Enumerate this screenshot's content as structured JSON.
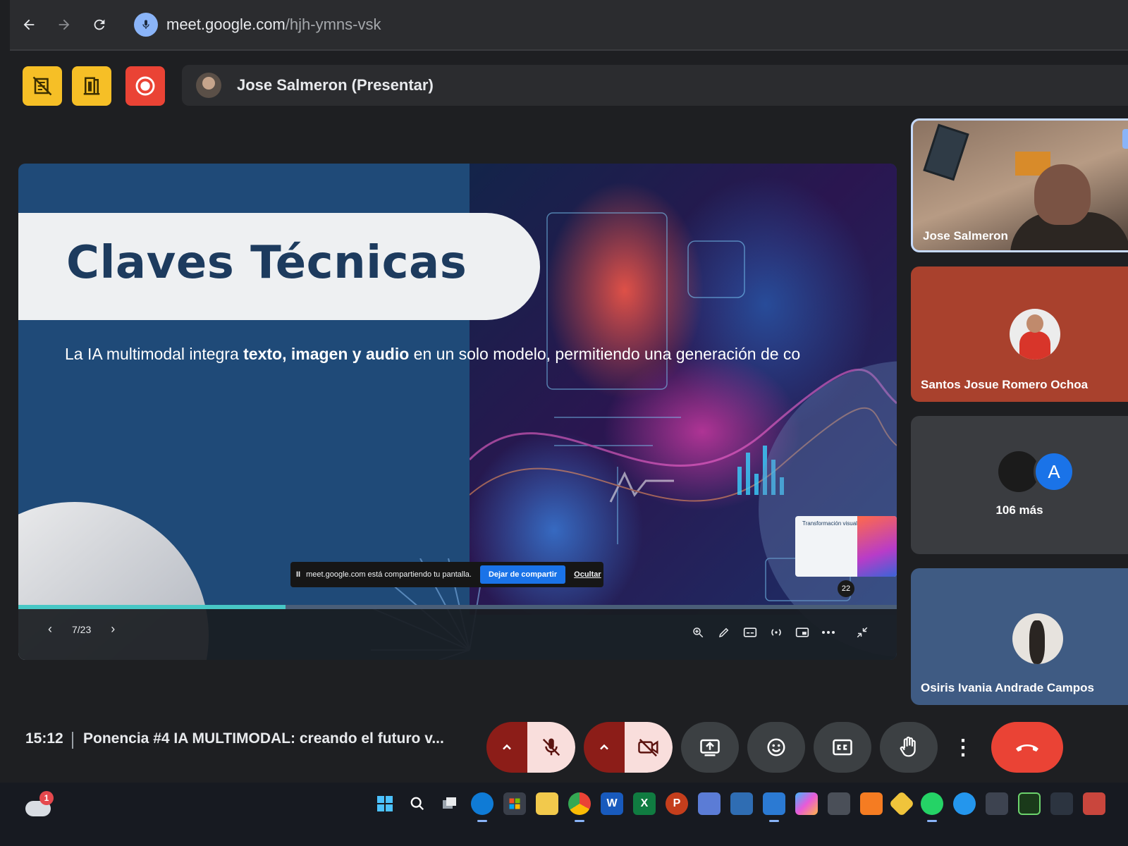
{
  "browser": {
    "url_host": "meet.google.com",
    "url_path": "/hjh-ymns-vsk",
    "icons": [
      "back-arrow-icon",
      "forward-arrow-icon",
      "reload-icon",
      "microphone-icon"
    ]
  },
  "presenter": {
    "name": "Jose Salmeron (Presentar)"
  },
  "slide": {
    "title": "Claves Técnicas",
    "text_prefix": "La IA multimodal integra ",
    "text_bold": "texto, imagen y audio",
    "text_suffix": " en un solo modelo, permitiendo una generación de co",
    "thumbnail_title": "Transformación visual",
    "badge_number": "22",
    "page_indicator": "7/23",
    "progress_fraction": 0.3043,
    "share_banner": {
      "pause_symbol": "II",
      "message": "meet.google.com está compartiendo tu pantalla.",
      "stop_label": "Dejar de compartir",
      "hide_label": "Ocultar"
    },
    "prev_symbol": "‹",
    "next_symbol": "›"
  },
  "participants": [
    {
      "name": "Jose Salmeron",
      "type": "video"
    },
    {
      "name": "Santos Josue Romero Ochoa",
      "type": "avatar"
    },
    {
      "more_letter": "A",
      "more_label": "106 más",
      "type": "more"
    },
    {
      "name": "Osiris Ivania Andrade Campos",
      "type": "avatar"
    }
  ],
  "bottom_bar": {
    "time": "15:12",
    "meeting_title": "Ponencia #4 IA MULTIMODAL: creando el futuro v...",
    "caret_symbol": "^",
    "more_symbol": "⋮"
  },
  "taskbar": {
    "notification_count": "1"
  },
  "colors": {
    "accent_blue": "#1a73e8",
    "leave_red": "#ea4335",
    "control_yellow": "#f6bf26",
    "muted_red": "#8c1d18",
    "muted_pink": "#f9dedc",
    "progress_teal": "#47c7c5"
  }
}
